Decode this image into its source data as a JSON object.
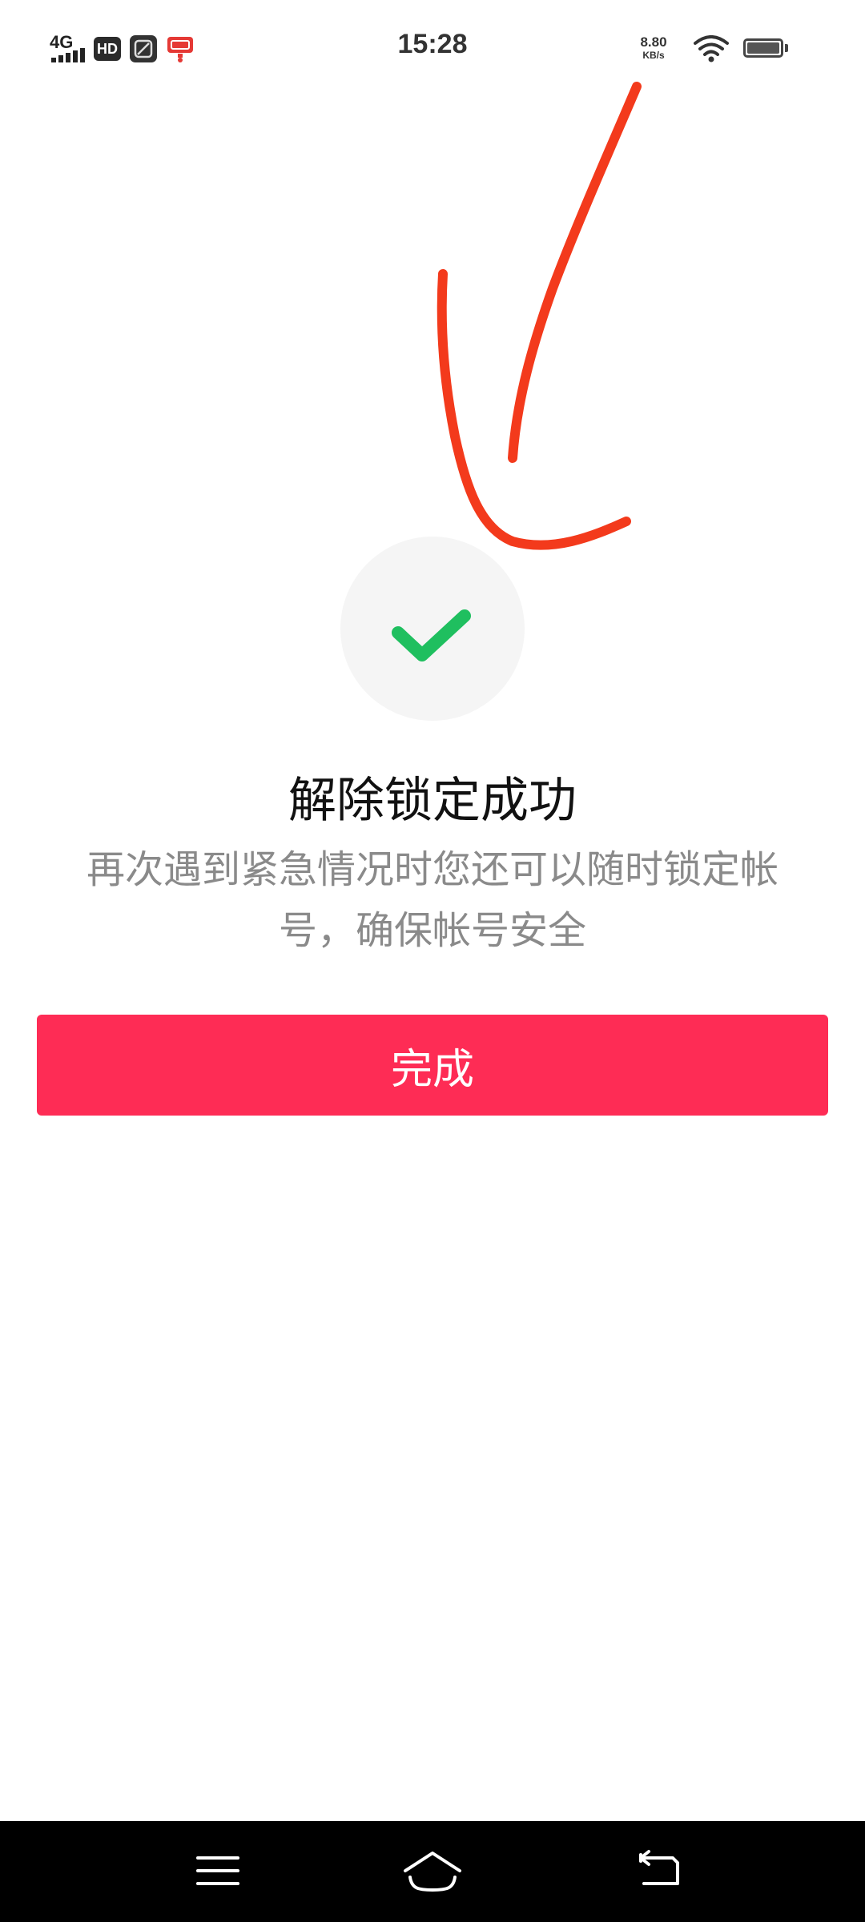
{
  "status_bar": {
    "network": "4G",
    "hd": "HD",
    "time": "15:28",
    "speed_value": "8.80",
    "speed_unit": "KB/s",
    "icons": [
      "signal-icon",
      "hd-icon",
      "app-notification-icon",
      "app-notification-icon",
      "wifi-icon",
      "battery-icon"
    ]
  },
  "annotation": {
    "color": "#f33a1c",
    "icon": "red-arrow-annotation"
  },
  "main": {
    "status_icon": "checkmark-icon",
    "check_color": "#1fbf5f",
    "title": "解除锁定成功",
    "subtitle": "再次遇到紧急情况时您还可以随时锁定帐号，确保帐号安全",
    "done_label": "完成",
    "accent_color": "#fe2c55"
  },
  "nav_bar": {
    "icons": [
      "menu-icon",
      "home-icon",
      "back-icon"
    ]
  }
}
